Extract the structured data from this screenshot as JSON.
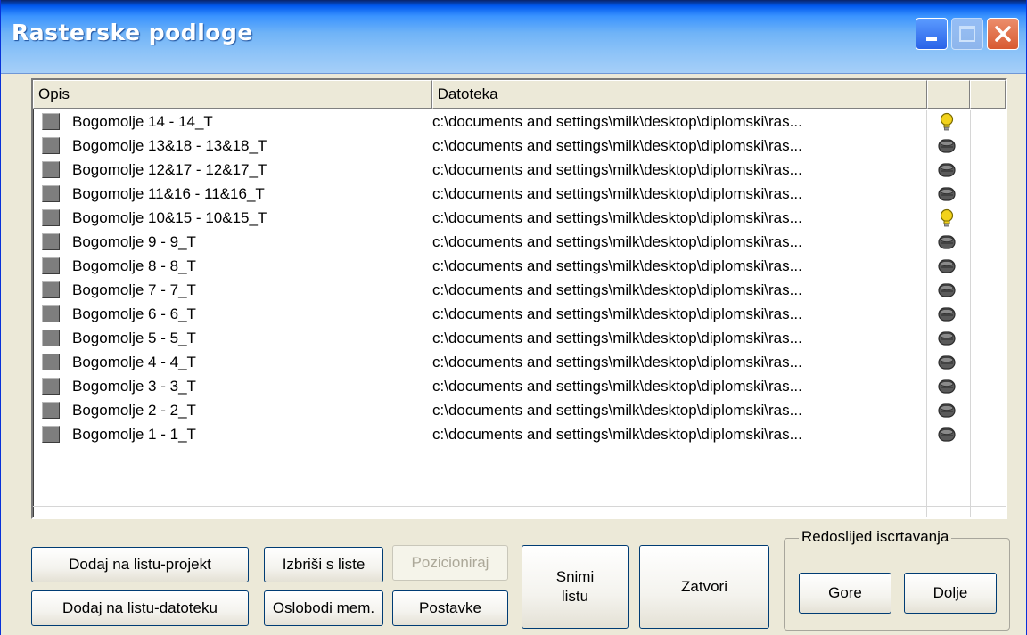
{
  "window": {
    "title": "Rasterske podloge"
  },
  "list": {
    "columns": [
      "Opis",
      "Datoteka",
      "",
      ""
    ],
    "rows": [
      {
        "opis": "Bogomolje 14 - 14_T",
        "datoteka": "c:\\documents and settings\\milk\\desktop\\diplomski\\ras...",
        "icon": "lightbulb-icon"
      },
      {
        "opis": "Bogomolje 13&18 - 13&18_T",
        "datoteka": "c:\\documents and settings\\milk\\desktop\\diplomski\\ras...",
        "icon": "database-icon"
      },
      {
        "opis": "Bogomolje 12&17 - 12&17_T",
        "datoteka": "c:\\documents and settings\\milk\\desktop\\diplomski\\ras...",
        "icon": "database-icon"
      },
      {
        "opis": "Bogomolje 11&16 - 11&16_T",
        "datoteka": "c:\\documents and settings\\milk\\desktop\\diplomski\\ras...",
        "icon": "database-icon"
      },
      {
        "opis": "Bogomolje 10&15 - 10&15_T",
        "datoteka": "c:\\documents and settings\\milk\\desktop\\diplomski\\ras...",
        "icon": "lightbulb-icon"
      },
      {
        "opis": "Bogomolje 9 - 9_T",
        "datoteka": "c:\\documents and settings\\milk\\desktop\\diplomski\\ras...",
        "icon": "database-icon"
      },
      {
        "opis": "Bogomolje 8 - 8_T",
        "datoteka": "c:\\documents and settings\\milk\\desktop\\diplomski\\ras...",
        "icon": "database-icon"
      },
      {
        "opis": "Bogomolje 7 - 7_T",
        "datoteka": "c:\\documents and settings\\milk\\desktop\\diplomski\\ras...",
        "icon": "database-icon"
      },
      {
        "opis": "Bogomolje 6 - 6_T",
        "datoteka": "c:\\documents and settings\\milk\\desktop\\diplomski\\ras...",
        "icon": "database-icon"
      },
      {
        "opis": "Bogomolje 5 - 5_T",
        "datoteka": "c:\\documents and settings\\milk\\desktop\\diplomski\\ras...",
        "icon": "database-icon"
      },
      {
        "opis": "Bogomolje 4 - 4_T",
        "datoteka": "c:\\documents and settings\\milk\\desktop\\diplomski\\ras...",
        "icon": "database-icon"
      },
      {
        "opis": "Bogomolje 3 - 3_T",
        "datoteka": "c:\\documents and settings\\milk\\desktop\\diplomski\\ras...",
        "icon": "database-icon"
      },
      {
        "opis": "Bogomolje 2 - 2_T",
        "datoteka": "c:\\documents and settings\\milk\\desktop\\diplomski\\ras...",
        "icon": "database-icon"
      },
      {
        "opis": "Bogomolje 1 - 1_T",
        "datoteka": "c:\\documents and settings\\milk\\desktop\\diplomski\\ras...",
        "icon": "database-icon"
      }
    ]
  },
  "buttons": {
    "add_project": "Dodaj na listu-projekt",
    "add_file": "Dodaj na listu-datoteku",
    "remove": "Izbriši s liste",
    "free_mem": "Oslobodi mem.",
    "position": "Pozicioniraj",
    "settings": "Postavke",
    "save_list_line1": "Snimi",
    "save_list_line2": "listu",
    "close": "Zatvori",
    "up": "Gore",
    "down": "Dolje"
  },
  "draw_order_group": {
    "label": "Redoslijed iscrtavanja"
  },
  "colors": {
    "title_gradient_start": "#0058ee",
    "close_button": "#d85a31",
    "lightbulb": "#f2d21b",
    "database": "#5a5a5a",
    "swatch": "#7e7e7e"
  }
}
